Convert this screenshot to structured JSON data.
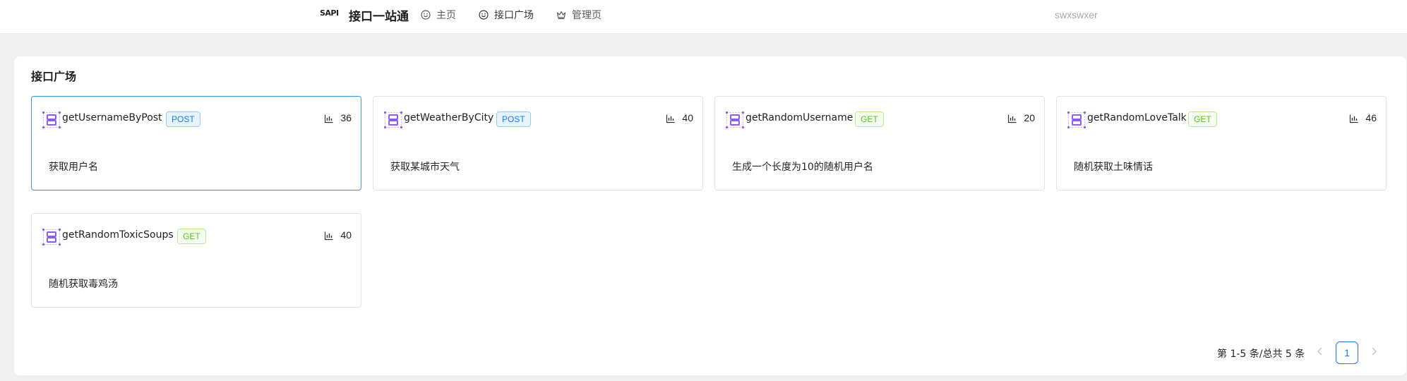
{
  "header": {
    "logo": "SAPI",
    "app_title": "接口一站通",
    "nav": [
      {
        "label": "主页",
        "icon": "smile-icon"
      },
      {
        "label": "接口广场",
        "icon": "smile-icon"
      },
      {
        "label": "管理页",
        "icon": "crown-icon"
      }
    ],
    "username": "swxswxer"
  },
  "main": {
    "title": "接口广场",
    "cards": [
      {
        "name": "getUsernameByPost",
        "method": "POST",
        "count": "36",
        "description": "获取用户名"
      },
      {
        "name": "getWeatherByCity",
        "method": "POST",
        "count": "40",
        "description": "获取某城市天气"
      },
      {
        "name": "getRandomUsername",
        "method": "GET",
        "count": "20",
        "description": "生成一个长度为10的随机用户名"
      },
      {
        "name": "getRandomLoveTalk",
        "method": "GET",
        "count": "46",
        "description": "随机获取土味情话"
      },
      {
        "name": "getRandomToxicSoups",
        "method": "GET",
        "count": "40",
        "description": "随机获取毒鸡汤"
      }
    ]
  },
  "pagination": {
    "total_text": "第 1-5 条/总共 5 条",
    "current_page": "1",
    "prev_icon": "chevron-left-icon",
    "next_icon": "chevron-right-icon"
  },
  "colors": {
    "accent": "#1677ff",
    "selected_border": "#2f9cf4",
    "post_tag": "#1677ff",
    "get_tag": "#52c41a",
    "api_icon": "#8b5cf6"
  }
}
